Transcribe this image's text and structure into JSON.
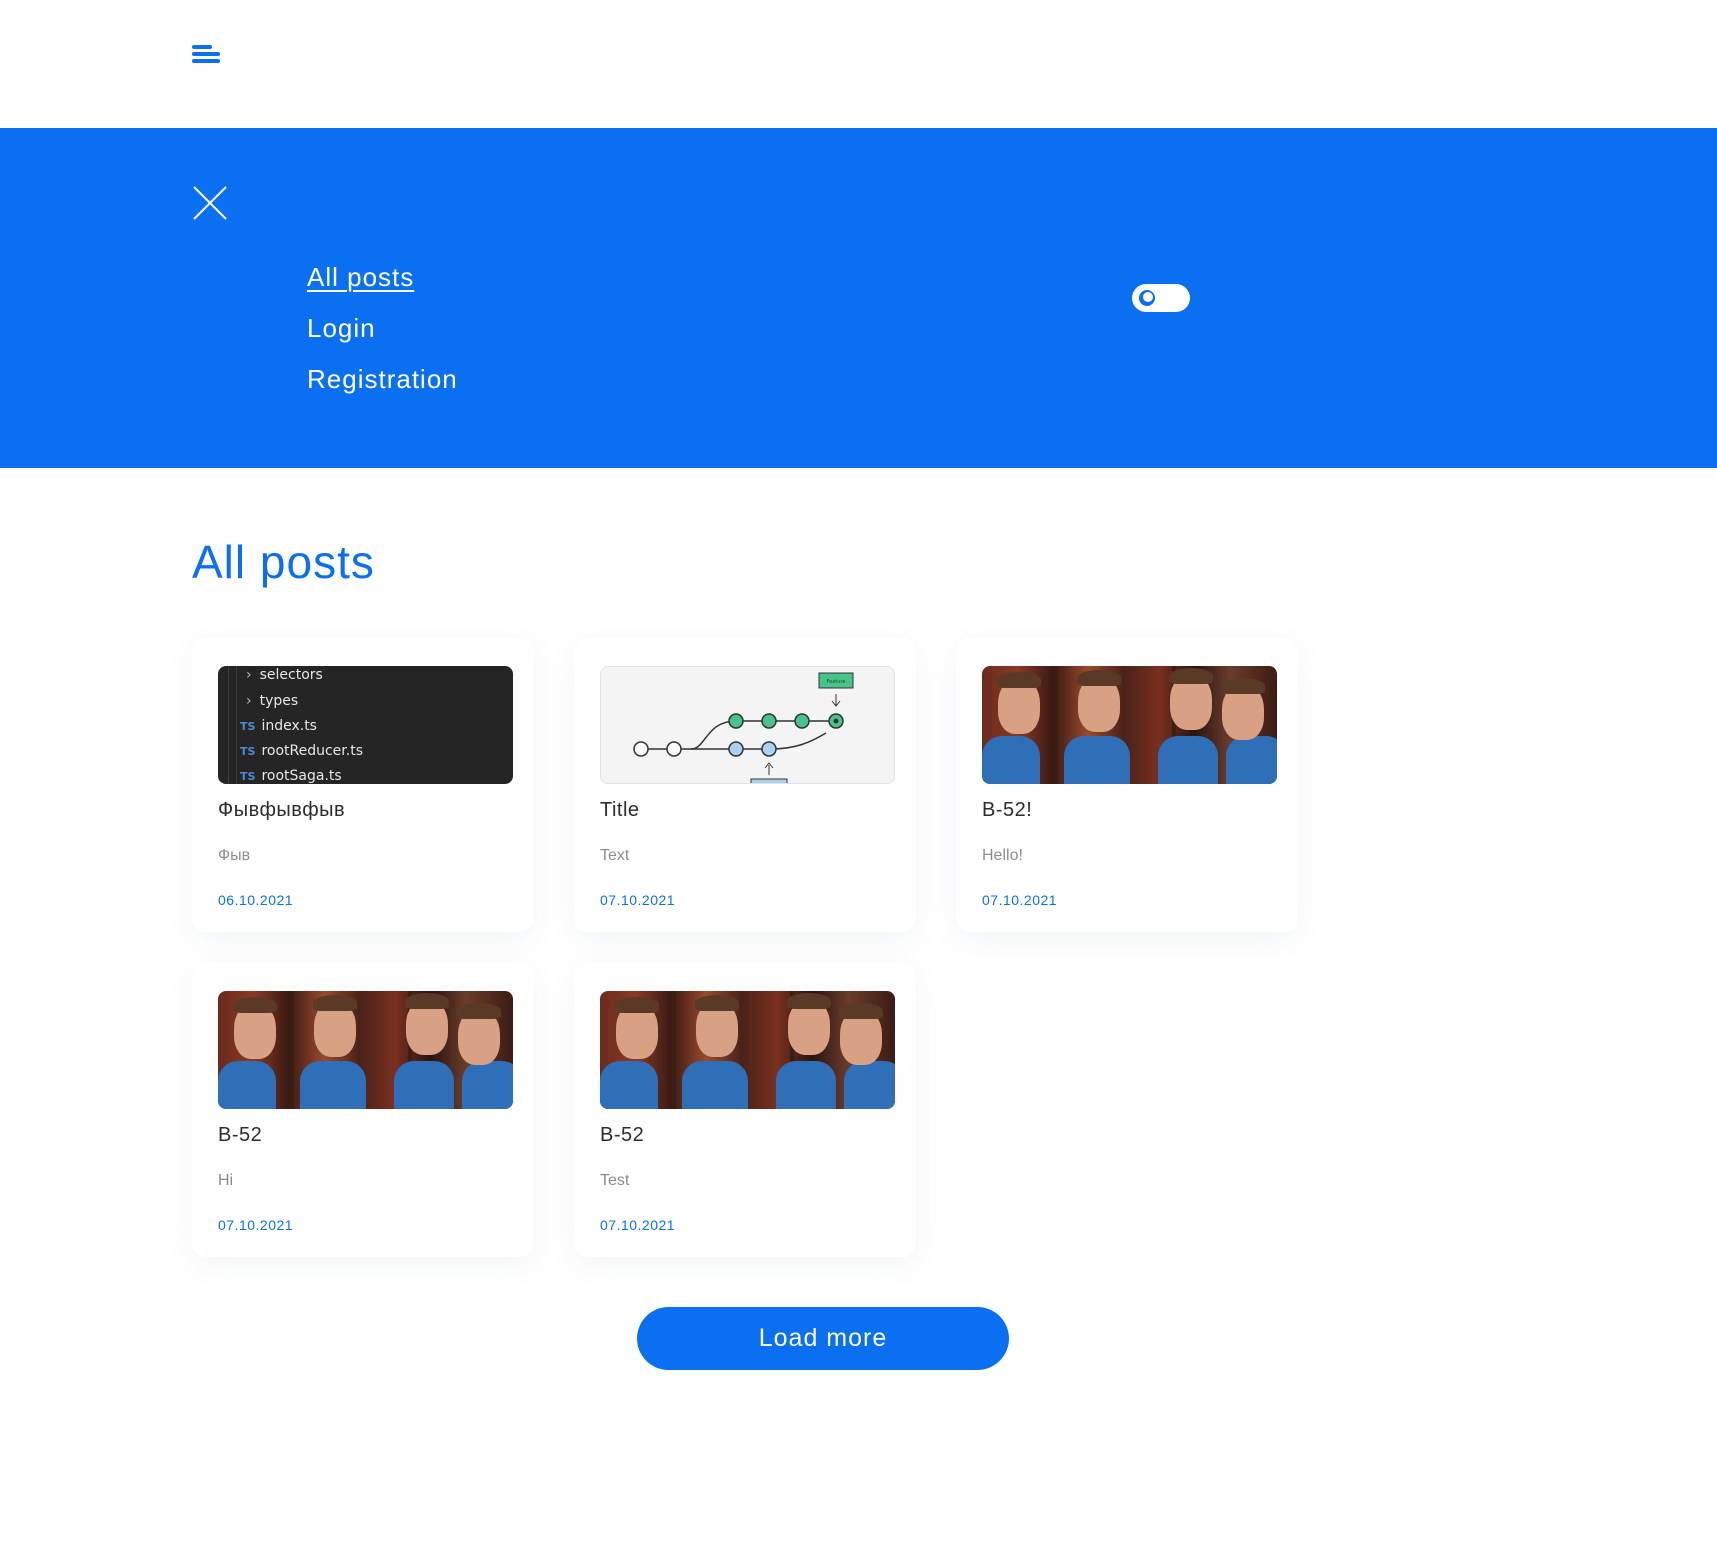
{
  "header": {
    "menu_icon": "hamburger-menu-icon"
  },
  "menu": {
    "close_icon": "close-icon",
    "items": [
      {
        "label": "All posts",
        "active": true
      },
      {
        "label": "Login",
        "active": false
      },
      {
        "label": "Registration",
        "active": false
      }
    ],
    "theme_toggle_icon": "moon-icon"
  },
  "main": {
    "title": "All posts",
    "posts": [
      {
        "title": "Фывфывфыв",
        "text": "Фыв",
        "date": "06.10.2021",
        "thumbnail": "code-editor-screenshot",
        "code_lines": [
          "selectors",
          "types",
          "index.ts",
          "rootReducer.ts",
          "rootSaga.ts"
        ]
      },
      {
        "title": "Title",
        "text": "Text",
        "date": "07.10.2021",
        "thumbnail": "git-branch-diagram",
        "diagram_label": "Feature"
      },
      {
        "title": "B-52!",
        "text": "Hello!",
        "date": "07.10.2021",
        "thumbnail": "photo"
      },
      {
        "title": "B-52",
        "text": "Hi",
        "date": "07.10.2021",
        "thumbnail": "photo"
      },
      {
        "title": "B-52",
        "text": "Test",
        "date": "07.10.2021",
        "thumbnail": "photo"
      }
    ],
    "load_more_label": "Load more"
  },
  "colors": {
    "accent": "#0a6ff0",
    "background": "#ffffff",
    "card_text": "#2d2d2d",
    "muted_text": "#8c8c8c"
  }
}
